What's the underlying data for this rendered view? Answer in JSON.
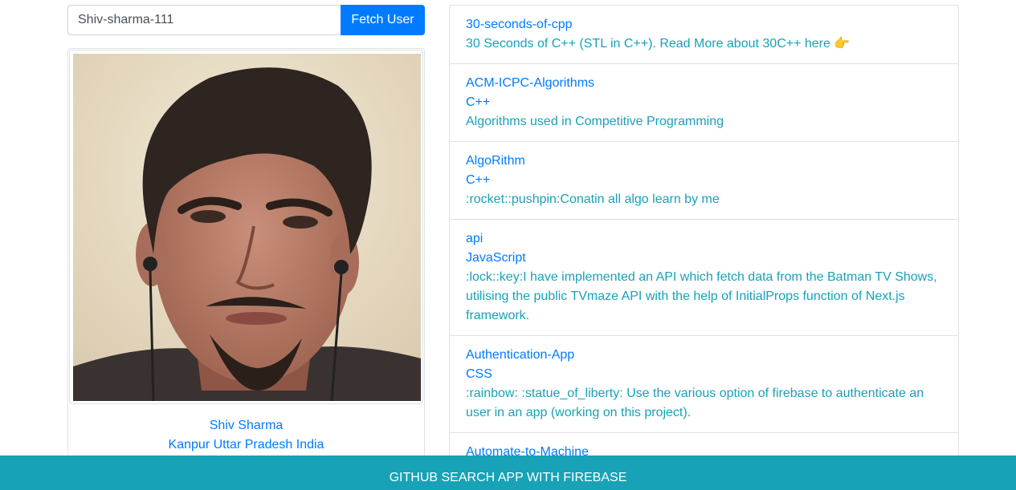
{
  "search": {
    "value": "Shiv-sharma-111",
    "button_label": "Fetch User"
  },
  "profile": {
    "name": "Shiv Sharma",
    "location": "Kanpur Uttar Pradesh India"
  },
  "repos": [
    {
      "name": "30-seconds-of-cpp",
      "language": "",
      "description": "30 Seconds of C++ (STL in C++). Read More about 30C++ here 👉"
    },
    {
      "name": "ACM-ICPC-Algorithms",
      "language": "C++",
      "description": "Algorithms used in Competitive Programming"
    },
    {
      "name": "AlgoRithm",
      "language": "C++",
      "description": ":rocket::pushpin:Conatin all algo learn by me"
    },
    {
      "name": "api",
      "language": "JavaScript",
      "description": ":lock::key:I have implemented an API which fetch data from the Batman TV Shows, utilising the public TVmaze API with the help of InitialProps function of Next.js framework."
    },
    {
      "name": "Authentication-App",
      "language": "CSS",
      "description": ":rainbow: :statue_of_liberty: Use the various option of firebase to authenticate an user in an app (working on this project)."
    },
    {
      "name": "Automate-to-Machine",
      "language": "",
      "description": ""
    }
  ],
  "footer": {
    "text": "GITHUB SEARCH APP WITH FIREBASE"
  },
  "colors": {
    "primary": "#007bff",
    "info": "#17a2b8",
    "border": "#dee2e6"
  }
}
